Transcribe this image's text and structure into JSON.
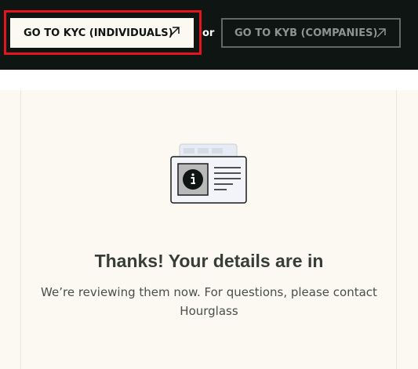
{
  "header": {
    "kyc_button_label": "GO TO KYC (INDIVIDUALS)",
    "or_label": "or",
    "kyb_button_label": "GO TO KYB (COMPANIES)",
    "arrow_icon": "arrow-up-right-icon"
  },
  "confirmation": {
    "illustration_icon": "id-card-info-icon",
    "title": "Thanks! Your details are in",
    "message": "We’re reviewing them now. For questions, please contact Hourglass"
  },
  "colors": {
    "header_bg": "#0e1512",
    "highlight": "#e3141c",
    "panel_bg": "#fbf9f1",
    "heading_text": "#373d39"
  }
}
